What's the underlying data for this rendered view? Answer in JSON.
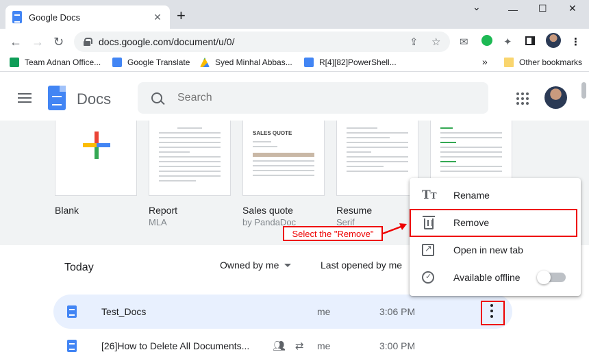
{
  "browser": {
    "tab_title": "Google Docs",
    "tab_close": "✕",
    "new_tab": "+",
    "url": "docs.google.com/document/u/0/",
    "bookmarks": [
      {
        "label": "Team Adnan Office...",
        "color": "#0f9d58"
      },
      {
        "label": "Google Translate",
        "color": "#4285f4"
      },
      {
        "label": "Syed Minhal Abbas...",
        "color": "#fbbc04"
      },
      {
        "label": "R[4][82]PowerShell...",
        "color": "#4285f4"
      }
    ],
    "bookmarks_overflow": "»",
    "other_bookmarks": "Other bookmarks"
  },
  "app": {
    "name": "Docs",
    "search_placeholder": "Search"
  },
  "templates": [
    {
      "name": "Blank",
      "sub": ""
    },
    {
      "name": "Report",
      "sub": "MLA"
    },
    {
      "name": "Sales quote",
      "sub": "by PandaDoc",
      "thumb_title": "SALES QUOTE"
    },
    {
      "name": "Resume",
      "sub": "Serif"
    }
  ],
  "list": {
    "section": "Today",
    "owner_filter": "Owned by me",
    "sort": "Last opened by me",
    "rows": [
      {
        "name": "Test_Docs",
        "owner": "me",
        "time": "3:06 PM"
      },
      {
        "name": "[26]How to Delete All Documents...",
        "owner": "me",
        "time": "3:00 PM"
      }
    ]
  },
  "menu": {
    "items": [
      {
        "label": "Rename",
        "icon": "rename-icon"
      },
      {
        "label": "Remove",
        "icon": "trash-icon"
      },
      {
        "label": "Open in new tab",
        "icon": "open-new-tab-icon"
      },
      {
        "label": "Available offline",
        "icon": "offline-icon"
      }
    ],
    "offline_enabled": false
  },
  "annotation": {
    "text": "Select the \"Remove\"",
    "color": "#ee0000"
  }
}
